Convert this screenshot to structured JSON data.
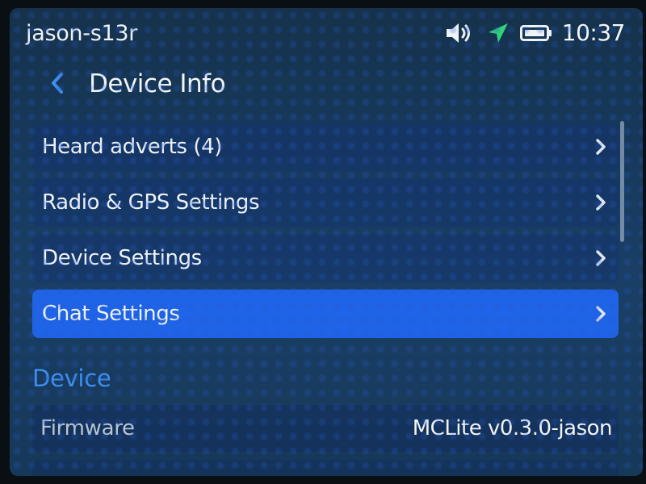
{
  "status_bar": {
    "device_name": "jason-s13r",
    "time": "10:37",
    "icons": [
      "speaker-icon",
      "gps-icon",
      "battery-icon"
    ]
  },
  "header": {
    "title": "Device Info",
    "back_icon": "chevron-left-icon"
  },
  "menu": {
    "items": [
      {
        "label": "Heard adverts (4)",
        "selected": false
      },
      {
        "label": "Radio & GPS Settings",
        "selected": false
      },
      {
        "label": "Device Settings",
        "selected": false
      },
      {
        "label": "Chat Settings",
        "selected": true
      }
    ]
  },
  "device_section": {
    "title": "Device",
    "rows": [
      {
        "label": "Firmware",
        "value": "MCLite v0.3.0-jason"
      }
    ]
  },
  "colors": {
    "accent": "#1f63e6",
    "section_header": "#3e8ef0",
    "gps_icon": "#2fd27a"
  }
}
